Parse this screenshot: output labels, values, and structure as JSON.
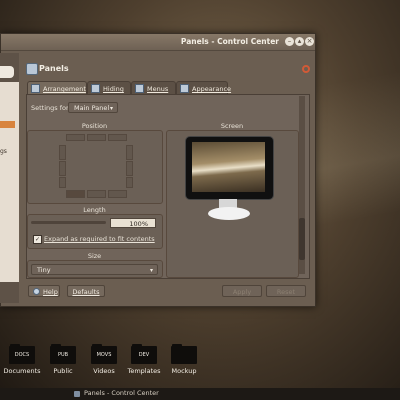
{
  "window": {
    "title": "Panels - Control Center",
    "controls": [
      "minimize",
      "maximize",
      "close"
    ]
  },
  "sidebar": {
    "partial_text": "gs"
  },
  "module": {
    "title": "Panels",
    "tabs": [
      {
        "label": "Arrangement",
        "active": true
      },
      {
        "label": "Hiding",
        "active": false
      },
      {
        "label": "Menus",
        "active": false
      },
      {
        "label": "Appearance",
        "active": false
      }
    ],
    "settings_for_label": "Settings for:",
    "settings_for_value": "Main Panel",
    "position_title": "Position",
    "screen_title": "Screen",
    "length_title": "Length",
    "length_value": "100%",
    "length_percent": 100,
    "expand_label": "Expand as required to fit contents",
    "expand_checked": true,
    "size_title": "Size",
    "size_value": "Tiny"
  },
  "buttons": {
    "help": "Help",
    "defaults": "Defaults",
    "apply": "Apply",
    "reset": "Reset"
  },
  "desktop_icons": [
    {
      "folder_label": "DOCS",
      "name": "Documents"
    },
    {
      "folder_label": "PUB",
      "name": "Public"
    },
    {
      "folder_label": "MOVS",
      "name": "Videos"
    },
    {
      "folder_label": "DEV",
      "name": "Templates"
    },
    {
      "folder_label": "",
      "name": "Mockup"
    }
  ],
  "taskbar": {
    "item": "Panels - Control Center"
  },
  "colors": {
    "accent": "#d8843e",
    "window_bg": "#6b5e51",
    "close_icon": "#d15a37"
  }
}
